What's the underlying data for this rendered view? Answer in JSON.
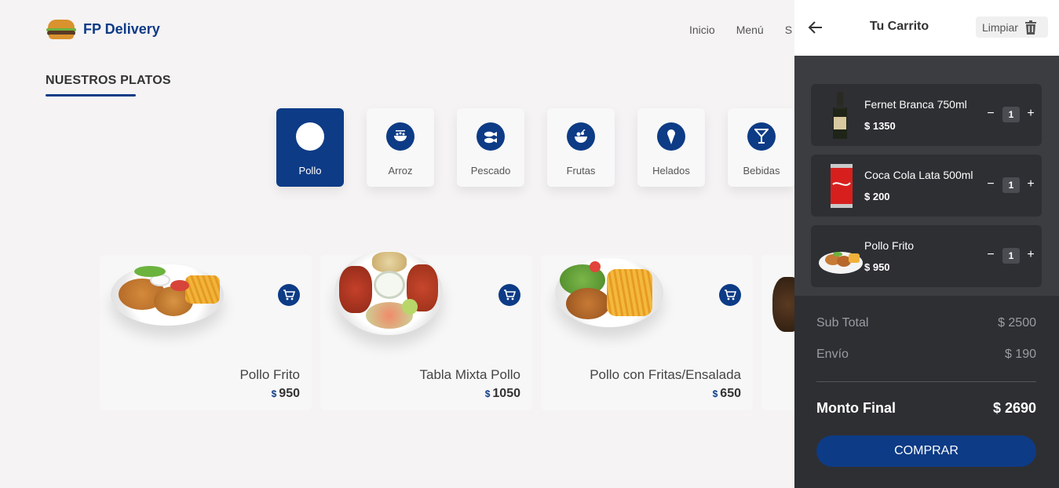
{
  "brand": {
    "name": "FP Delivery",
    "logo_icon": "burger-icon"
  },
  "nav": {
    "items": [
      "Inicio",
      "Menú",
      "S"
    ]
  },
  "section": {
    "title": "NUESTROS PLATOS"
  },
  "categories": [
    {
      "label": "Pollo",
      "icon": "chicken-icon",
      "active": true
    },
    {
      "label": "Arroz",
      "icon": "rice-bowl-icon",
      "active": false
    },
    {
      "label": "Pescado",
      "icon": "fish-icon",
      "active": false
    },
    {
      "label": "Frutas",
      "icon": "fruit-bowl-icon",
      "active": false
    },
    {
      "label": "Helados",
      "icon": "ice-cream-icon",
      "active": false
    },
    {
      "label": "Bebidas",
      "icon": "cocktail-icon",
      "active": false
    }
  ],
  "dishes": [
    {
      "name": "Pollo Frito",
      "currency": "$",
      "price": "950"
    },
    {
      "name": "Tabla Mixta Pollo",
      "currency": "$",
      "price": "1050"
    },
    {
      "name": "Pollo con Fritas/Ensalada",
      "currency": "$",
      "price": "650"
    }
  ],
  "cart": {
    "title": "Tu Carrito",
    "clear_label": "Limpiar",
    "items": [
      {
        "name": "Fernet Branca 750ml",
        "price": "$ 1350",
        "qty": "1",
        "minus": "−",
        "plus": "+"
      },
      {
        "name": "Coca Cola Lata 500ml",
        "price": "$ 200",
        "qty": "1",
        "minus": "−",
        "plus": "+"
      },
      {
        "name": "Pollo Frito",
        "price": "$ 950",
        "qty": "1",
        "minus": "−",
        "plus": "+"
      }
    ],
    "subtotal_label": "Sub Total",
    "subtotal_value": "$ 2500",
    "shipping_label": "Envío",
    "shipping_value": "$ 190",
    "total_label": "Monto Final",
    "total_value": "$ 2690",
    "buy_label": "COMPRAR"
  },
  "colors": {
    "accent": "#0d3b86",
    "cart_bg": "#2e2f33",
    "page_bg": "#f5f3f4"
  }
}
